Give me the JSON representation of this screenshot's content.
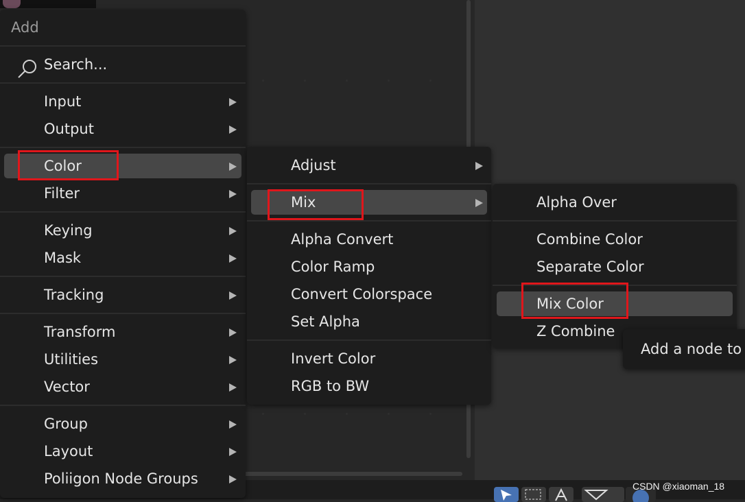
{
  "menu_add": {
    "title": "Add",
    "search_placeholder": "Search...",
    "items": [
      {
        "label": "Input"
      },
      {
        "label": "Output"
      },
      {
        "label": "Color"
      },
      {
        "label": "Filter"
      },
      {
        "label": "Keying"
      },
      {
        "label": "Mask"
      },
      {
        "label": "Tracking"
      },
      {
        "label": "Transform"
      },
      {
        "label": "Utilities"
      },
      {
        "label": "Vector"
      },
      {
        "label": "Group"
      },
      {
        "label": "Layout"
      },
      {
        "label": "Poliigon Node Groups"
      }
    ]
  },
  "menu_color": {
    "items": [
      {
        "label": "Adjust"
      },
      {
        "label": "Mix"
      },
      {
        "label": "Alpha Convert"
      },
      {
        "label": "Color Ramp"
      },
      {
        "label": "Convert Colorspace"
      },
      {
        "label": "Set Alpha"
      },
      {
        "label": "Invert Color"
      },
      {
        "label": "RGB to BW"
      }
    ]
  },
  "menu_mix": {
    "items": [
      {
        "label": "Alpha Over"
      },
      {
        "label": "Combine Color"
      },
      {
        "label": "Separate Color"
      },
      {
        "label": "Mix Color"
      },
      {
        "label": "Z Combine"
      }
    ]
  },
  "tooltip": {
    "text": "Add a node to"
  },
  "watermark": {
    "text": "CSDN @xiaoman_18"
  },
  "colors": {
    "highlight": "#474747",
    "annotation_red": "#e0161b",
    "menu_bg": "#1d1d1d"
  }
}
